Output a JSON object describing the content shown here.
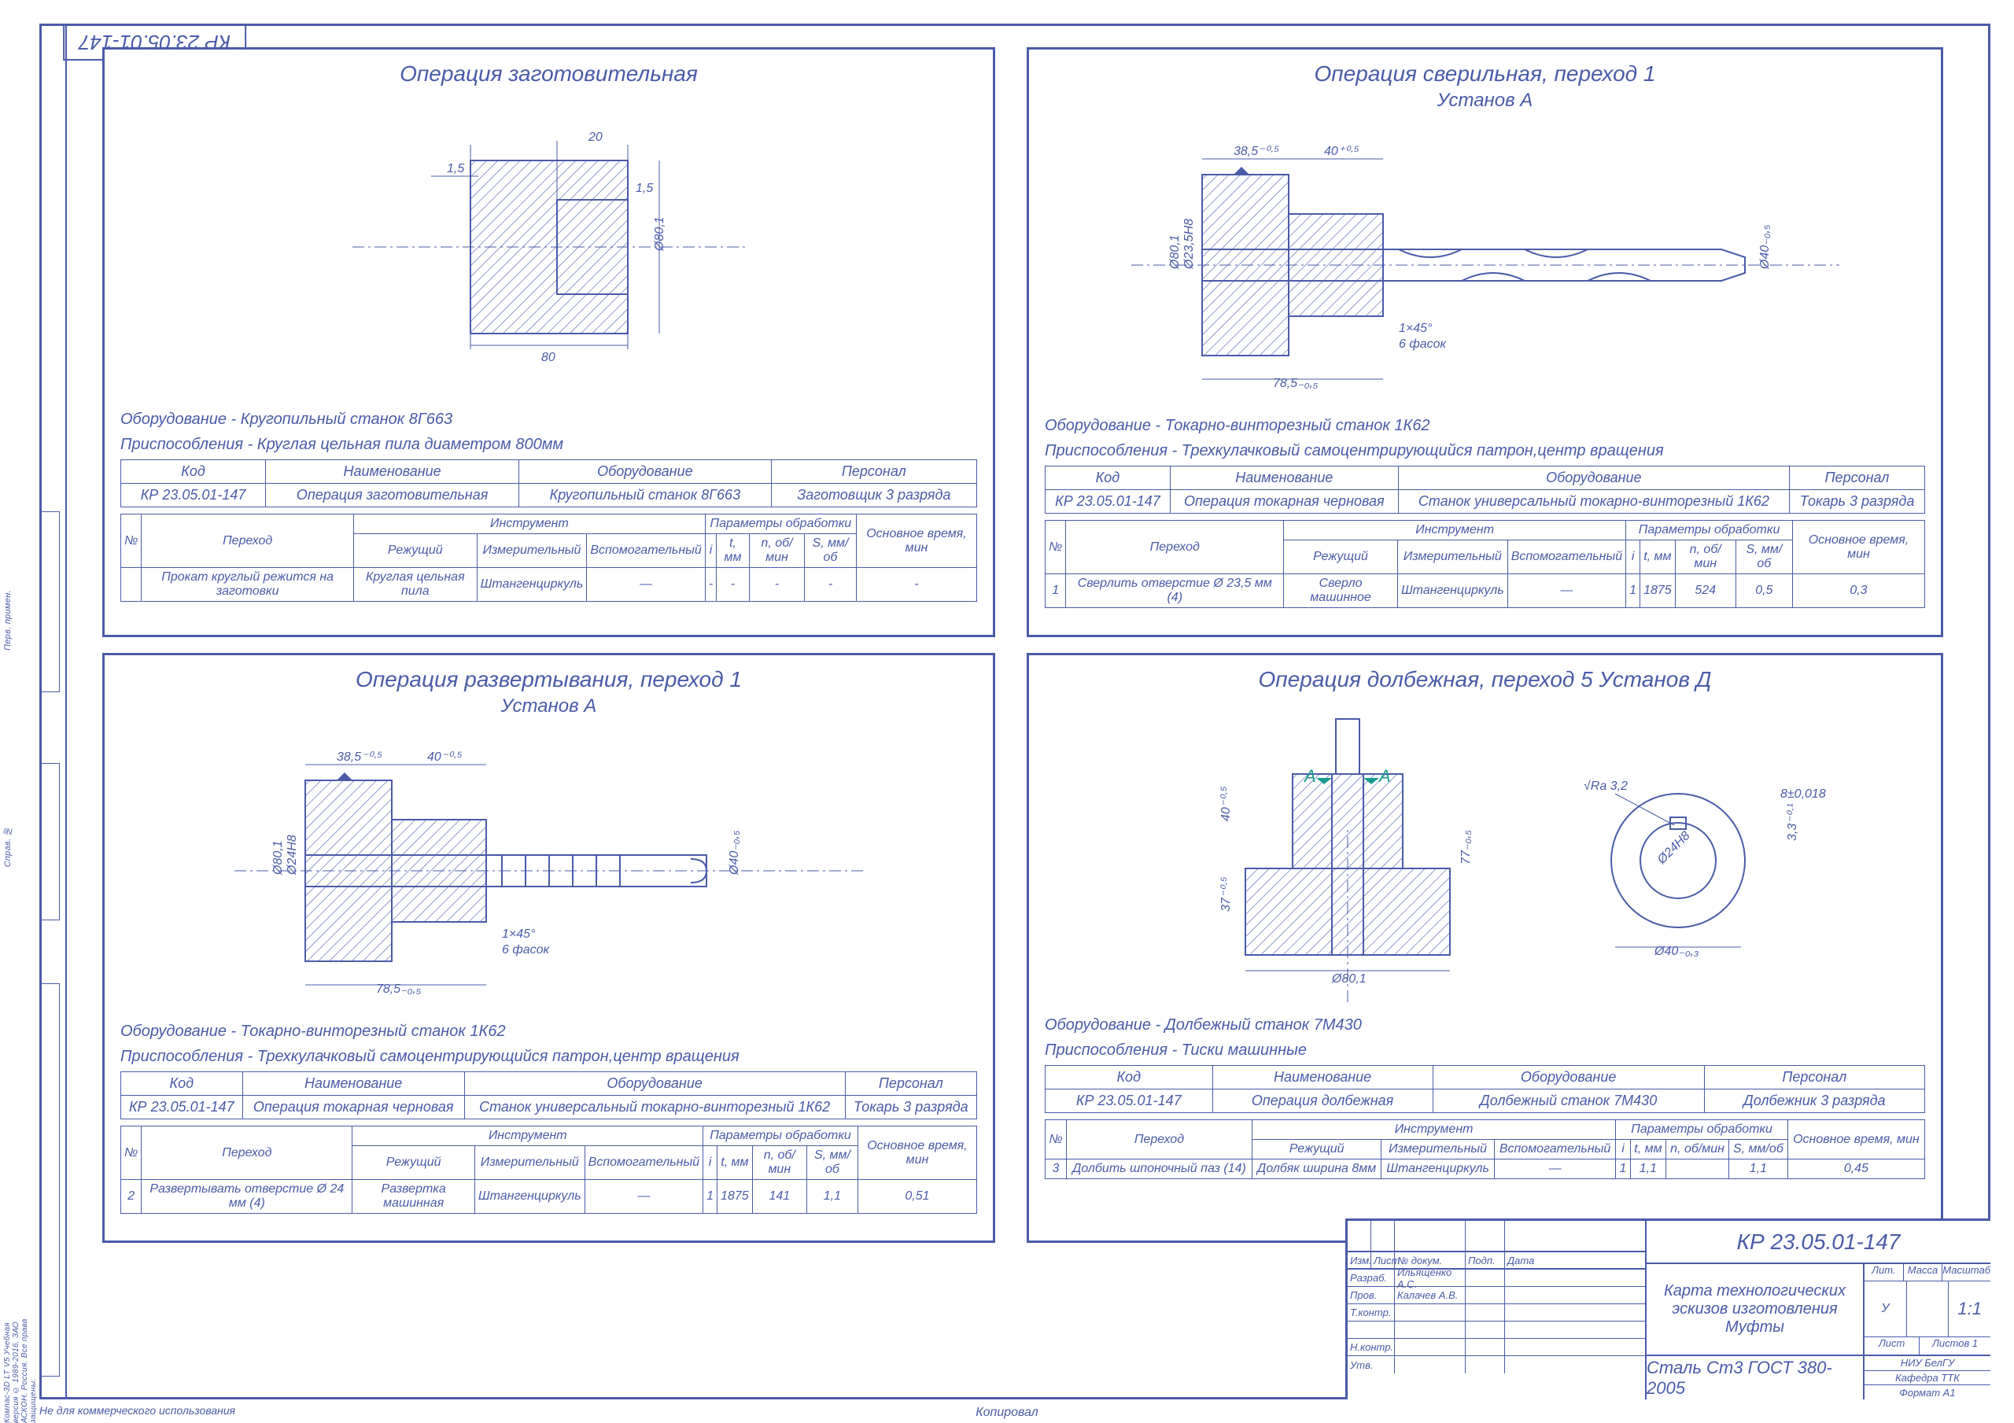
{
  "doc_code": "КР 23.05.01-147",
  "side": {
    "a": "Перв. примен.",
    "b": "Справ. №",
    "c": "Компас-3D LT V5 Учебная версия © 1989-2016, ЗАО АСКОН. Россия. Все права защищены."
  },
  "footer": "Не для коммерческого использования",
  "kopir": "Копировал",
  "corner_tag": "КР 23.05.01-147",
  "q1": {
    "title": "Операция заготовительная",
    "dims": {
      "d1": "1,5",
      "d2": "20",
      "d3": "1,5",
      "w": "80",
      "dia": "Ø80,1"
    },
    "eq": "Оборудование - Кругопильный станок 8Г663",
    "fix": "Приспособления - Круглая цельная пила диаметром 800мм",
    "t1": {
      "h": [
        "Код",
        "Наименование",
        "Оборудование",
        "Персонал"
      ],
      "r": [
        "КР 23.05.01-147",
        "Операция заготовительная",
        "Кругопильный станок 8Г663",
        "Заготовщик 3 разряда"
      ]
    },
    "t2": {
      "h1": [
        "№",
        "Переход",
        "Инструмент",
        "Параметры обработки",
        "Основное время, мин"
      ],
      "h2": [
        "Режущий",
        "Измерительный",
        "Вспомогательный",
        "i",
        "t, мм",
        "n, об/мин",
        "S, мм/об"
      ],
      "r": [
        "",
        "Прокат круглый режится на заготовки",
        "Круглая цельная пила",
        "Штангенциркуль",
        "—",
        "-",
        "-",
        "-",
        "-",
        "-"
      ]
    }
  },
  "q2": {
    "title": "Операция сверильная, переход 1",
    "sub": "Установ А",
    "dims": {
      "a": "38,5⁻⁰·⁵",
      "b": "40⁺⁰·⁵",
      "dia1": "Ø80,1",
      "dia2": "Ø23,5H8",
      "dia3": "Ø40₋₀,₅",
      "ch": "1×45°",
      "chn": "6 фасок",
      "len": "78,5₋₀,₅"
    },
    "eq": "Оборудование - Токарно-винторезный станок 1К62",
    "fix": "Приспособления - Трехкулачковый самоцентрирующийся патрон,центр вращения",
    "t1": {
      "h": [
        "Код",
        "Наименование",
        "Оборудование",
        "Персонал"
      ],
      "r": [
        "КР 23.05.01-147",
        "Операция токарная черновая",
        "Станок универсальный токарно-винторезный 1К62",
        "Токарь 3 разряда"
      ]
    },
    "t2": {
      "h1": [
        "№",
        "Переход",
        "Инструмент",
        "Параметры обработки",
        "Основное время, мин"
      ],
      "h2": [
        "Режущий",
        "Измерительный",
        "Вспомогательный",
        "i",
        "t, мм",
        "n, об/мин",
        "S, мм/об"
      ],
      "r": [
        "1",
        "Сверлить отверстие Ø 23,5 мм (4)",
        "Сверло машинное",
        "Штангенциркуль",
        "—",
        "1",
        "1875",
        "524",
        "0,5",
        "0,3"
      ]
    }
  },
  "q3": {
    "title": "Операция развертывания, переход 1",
    "sub": "Установ А",
    "dims": {
      "a": "38,5⁻⁰·⁵",
      "b": "40⁻⁰·⁵",
      "dia1": "Ø80,1",
      "dia2": "Ø24H8",
      "dia3": "Ø40₋₀,₅",
      "ch": "1×45°",
      "chn": "6 фасок",
      "len": "78,5₋₀,₅"
    },
    "eq": "Оборудование - Токарно-винторезный станок 1К62",
    "fix": "Приспособления - Трехкулачковый самоцентрирующийся патрон,центр вращения",
    "t1": {
      "h": [
        "Код",
        "Наименование",
        "Оборудование",
        "Персонал"
      ],
      "r": [
        "КР 23.05.01-147",
        "Операция токарная черновая",
        "Станок универсальный токарно-винторезный 1К62",
        "Токарь 3 разряда"
      ]
    },
    "t2": {
      "h1": [
        "№",
        "Переход",
        "Инструмент",
        "Параметры обработки",
        "Основное время, мин"
      ],
      "h2": [
        "Режущий",
        "Измерительный",
        "Вспомогательный",
        "i",
        "t, мм",
        "n, об/мин",
        "S, мм/об"
      ],
      "r": [
        "2",
        "Развертывать отверстие Ø 24 мм (4)",
        "Развертка машинная",
        "Штангенциркуль",
        "—",
        "1",
        "1875",
        "141",
        "1,1",
        "0,51"
      ]
    }
  },
  "q4": {
    "title": "Операция долбежная, переход 5 Установ Д",
    "dims": {
      "h1": "40⁻⁰·⁵",
      "h2": "37⁻⁰·⁵",
      "tot": "77₋₀,₅",
      "dia": "Ø80,1",
      "ra": "√Ra 3,2",
      "key": "8±0,018",
      "kh": "3,3⁻⁰·¹",
      "cd": "Ø24H8",
      "od": "Ø40₋₀,₃"
    },
    "eq": "Оборудование - Долбежный станок 7М430",
    "fix": "Приспособления - Тиски машинные",
    "t1": {
      "h": [
        "Код",
        "Наименование",
        "Оборудование",
        "Персонал"
      ],
      "r": [
        "КР 23.05.01-147",
        "Операция долбежная",
        "Долбежный станок 7М430",
        "Долбежник 3 разряда"
      ]
    },
    "t2": {
      "h1": [
        "№",
        "Переход",
        "Инструмент",
        "Параметры обработки",
        "Основное время, мин"
      ],
      "h2": [
        "Режущий",
        "Измерительный",
        "Вспомогательный",
        "i",
        "t, мм",
        "n, об/мин",
        "S, мм/об"
      ],
      "r": [
        "3",
        "Долбить шпоночный паз (14)",
        "Долбяк ширина 8мм",
        "Штангенциркуль",
        "—",
        "1",
        "1,1",
        "",
        "1,1",
        "0,45"
      ]
    }
  },
  "tb": {
    "code": "КР 23.05.01-147",
    "name": "Карта технологических эскизов изготовления Муфты",
    "mat": "Сталь Ст3 ГОСТ 380-2005",
    "scale": "1:1",
    "hdr": [
      "Изм.",
      "Лист",
      "№ докум.",
      "Подп.",
      "Дата"
    ],
    "rows": [
      [
        "Разраб.",
        "Ильященко А.С.",
        "",
        ""
      ],
      [
        "Пров.",
        "Калачев А.В.",
        "",
        ""
      ],
      [
        "Т.контр.",
        "",
        "",
        ""
      ],
      [
        "",
        "",
        "",
        ""
      ],
      [
        "Н.контр.",
        "",
        "",
        ""
      ],
      [
        "Утв.",
        "",
        "",
        ""
      ]
    ],
    "mini": {
      "lit": "Лит.",
      "mass": "Масса",
      "msht": "Масштаб",
      "u": "У",
      "list": "Лист",
      "listov": "Листов  1",
      "dept": "НИУ БелГУ",
      "kaf": "Кафедра ТТК",
      "fmt": "Формат   A1"
    }
  }
}
